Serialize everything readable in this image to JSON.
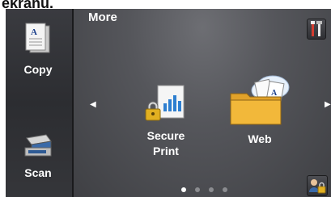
{
  "caption": "ekranu.",
  "screen": {
    "title": "More",
    "sidebar": [
      {
        "label": "Copy",
        "icon": "copy-document-icon"
      },
      {
        "label": "Scan",
        "icon": "scanner-icon"
      }
    ],
    "apps": [
      {
        "label_line1": "Secure",
        "label_line2": "Print",
        "icon": "secure-print-icon"
      },
      {
        "label": "Web",
        "icon": "web-folder-cloud-icon"
      }
    ],
    "page_indicator": {
      "count": 4,
      "current": 1
    },
    "corner_buttons": [
      "settings-tools-icon",
      "user-lock-icon"
    ]
  }
}
